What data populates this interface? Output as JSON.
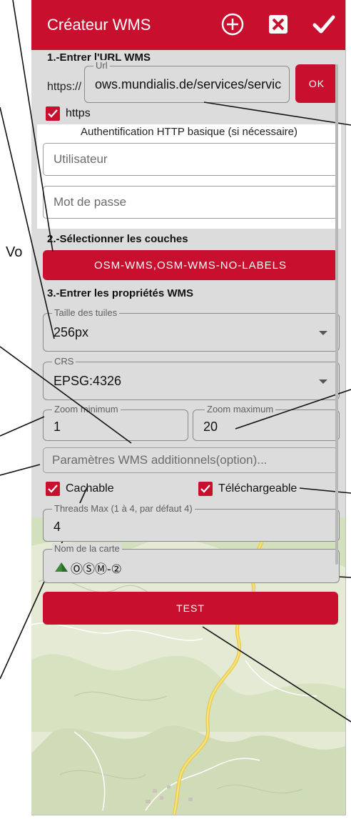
{
  "header": {
    "title": "Créateur WMS",
    "icons": [
      "add-circle-icon",
      "close-box-icon",
      "check-icon"
    ]
  },
  "step1": {
    "heading": "1.-Entrer l'URL WMS",
    "prefix": "https://",
    "url_legend": "Url",
    "url_value": "ows.mundialis.de/services/service?",
    "ok_label": "OK",
    "https_label": "https",
    "https_checked": true,
    "auth_heading": "Authentification HTTP basique (si nécessaire)",
    "user_placeholder": "Utilisateur",
    "pass_placeholder": "Mot de passe"
  },
  "step2": {
    "heading": "2.-Sélectionner les couches",
    "layers_button": "OSM-WMS,OSM-WMS-NO-LABELS"
  },
  "step3": {
    "heading": "3.-Entrer les propriétés WMS",
    "tile_size_legend": "Taille des tuiles",
    "tile_size_value": "256px",
    "crs_legend": "CRS",
    "crs_value": "EPSG:4326",
    "zoom_min_legend": "Zoom minimum",
    "zoom_min_value": "1",
    "zoom_max_legend": "Zoom maximum",
    "zoom_max_value": "20",
    "extra_params_placeholder": "Paramètres WMS additionnels(option)...",
    "cachable_label": "Cachable",
    "cachable_checked": true,
    "downloadable_label": "Téléchargeable",
    "downloadable_checked": true,
    "threads_legend": "Threads Max (1 à 4, par défaut 4)",
    "threads_value": "4",
    "map_name_legend": "Nom de la carte",
    "map_name_value": "ⓄⓈⓂ-②",
    "test_label": "TEST"
  },
  "outside_text": "Vo",
  "colors": {
    "accent": "#c8102e",
    "panel": "#dcdcdc"
  }
}
